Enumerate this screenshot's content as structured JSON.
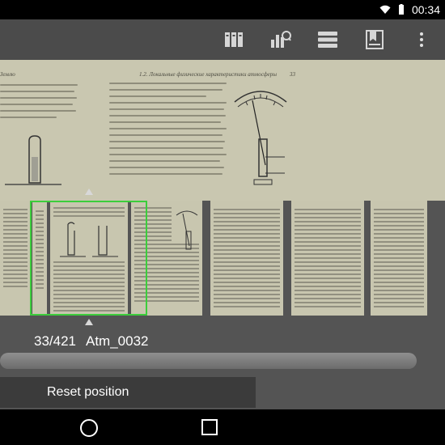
{
  "status_bar": {
    "time": "00:34",
    "icons": [
      "wifi-icon",
      "battery-icon"
    ]
  },
  "toolbar": {
    "buttons": [
      {
        "name": "library-icon"
      },
      {
        "name": "stats-icon"
      },
      {
        "name": "list-icon"
      },
      {
        "name": "bookmark-icon"
      },
      {
        "name": "more-icon"
      }
    ]
  },
  "page_view": {
    "left_heading": "Землю",
    "right_heading": "1.2. Локальные физические характеристики атмосферы",
    "page_number": "33"
  },
  "thumbnails": {
    "selected_index": 1,
    "count_visible": 6
  },
  "page_info": {
    "position": "33/421",
    "file_name": "Atm_0032"
  },
  "reset_button": {
    "label": "Reset position"
  },
  "navigation": {
    "buttons": [
      "home-icon",
      "recents-icon"
    ]
  },
  "colors": {
    "selection": "#3ccd3c",
    "toolbar": "#4b4b4b",
    "paper": "#c9c7b0"
  }
}
